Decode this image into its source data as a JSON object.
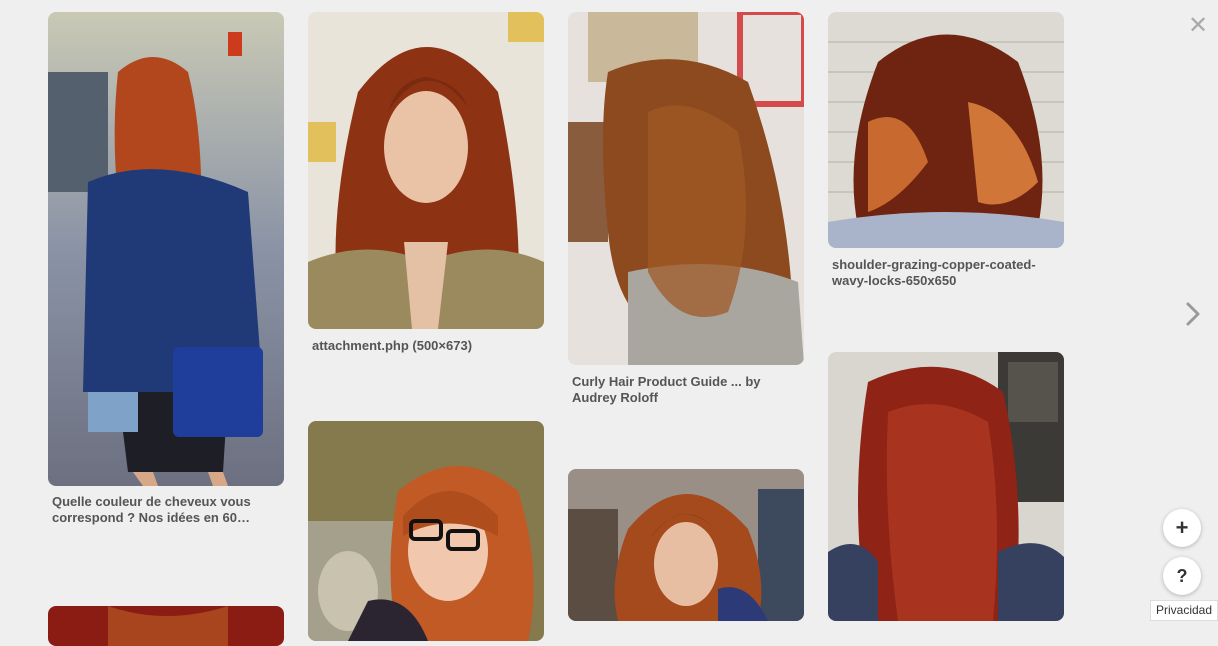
{
  "pins": [
    {
      "id": "pin1",
      "caption": "Quelle couleur de cheveux vous correspond ? Nos idées en 60…"
    },
    {
      "id": "pin2",
      "caption": "attachment.php (500×673)"
    },
    {
      "id": "pin3",
      "caption": "Curly Hair Product Guide ... by Audrey Roloff"
    },
    {
      "id": "pin4",
      "caption": "shoulder-grazing-copper-coated-wavy-locks-650x650"
    },
    {
      "id": "pin5",
      "caption": ""
    },
    {
      "id": "pin6",
      "caption": ""
    },
    {
      "id": "pin7",
      "caption": ""
    },
    {
      "id": "pin8",
      "caption": ""
    }
  ],
  "controls": {
    "close_glyph": "✕",
    "add_glyph": "+",
    "help_glyph": "?",
    "privacy_label": "Privacidad"
  }
}
